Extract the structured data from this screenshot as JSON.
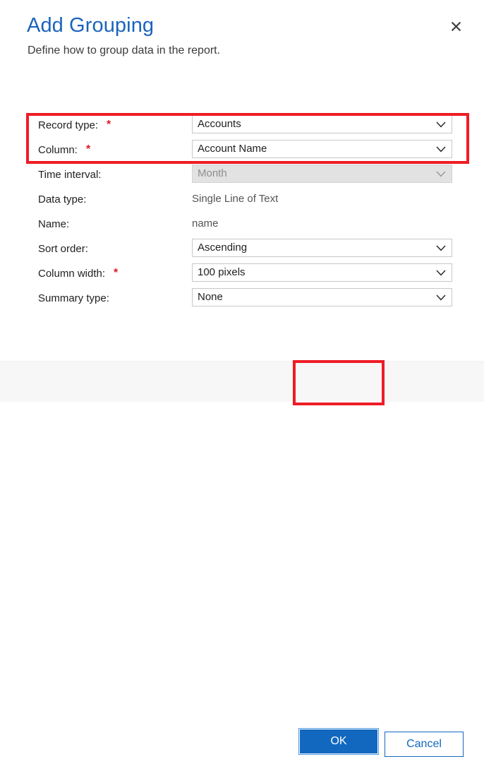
{
  "dialog": {
    "title": "Add Grouping",
    "subtitle": "Define how to group data in the report.",
    "close_icon": "close-icon"
  },
  "form": {
    "rows": [
      {
        "label": "Record type:",
        "required": true,
        "required_marker": "*",
        "control": "dropdown",
        "value": "Accounts",
        "disabled": false,
        "chevron_icon": "chevron-down-icon",
        "name": "record-type"
      },
      {
        "label": "Column:",
        "required": true,
        "required_marker": "*",
        "control": "dropdown",
        "value": "Account Name",
        "disabled": false,
        "chevron_icon": "chevron-down-icon",
        "name": "column"
      },
      {
        "label": "Time interval:",
        "required": false,
        "required_marker": "",
        "control": "dropdown",
        "value": "Month",
        "disabled": true,
        "chevron_icon": "chevron-down-icon",
        "name": "time-interval"
      },
      {
        "label": "Data type:",
        "required": false,
        "required_marker": "",
        "control": "static",
        "value": "Single Line of Text",
        "disabled": false,
        "chevron_icon": "",
        "name": "data-type"
      },
      {
        "label": "Name:",
        "required": false,
        "required_marker": "",
        "control": "static",
        "value": "name",
        "disabled": false,
        "chevron_icon": "",
        "name": "name"
      },
      {
        "label": "Sort order:",
        "required": false,
        "required_marker": "",
        "control": "dropdown",
        "value": "Ascending",
        "disabled": false,
        "chevron_icon": "chevron-down-icon",
        "name": "sort-order"
      },
      {
        "label": "Column width:",
        "required": true,
        "required_marker": "*",
        "control": "dropdown",
        "value": "100 pixels",
        "disabled": false,
        "chevron_icon": "chevron-down-icon",
        "name": "column-width"
      },
      {
        "label": "Summary type:",
        "required": false,
        "required_marker": "",
        "control": "dropdown",
        "value": "None",
        "disabled": false,
        "chevron_icon": "chevron-down-icon",
        "name": "summary-type"
      }
    ]
  },
  "footer": {
    "ok_label": "OK",
    "cancel_label": "Cancel"
  },
  "annotations": {
    "required_fields_highlight": "red-box-around-record-type-and-column",
    "ok_button_highlight": "red-box-around-ok-button"
  },
  "colors": {
    "title_blue": "#1b64bd",
    "accent_blue": "#1268bf",
    "annotation_red": "#ee1c25",
    "required_red": "#e01a22",
    "footer_bg": "#f7f7f7",
    "disabled_bg": "#e2e2e2"
  }
}
